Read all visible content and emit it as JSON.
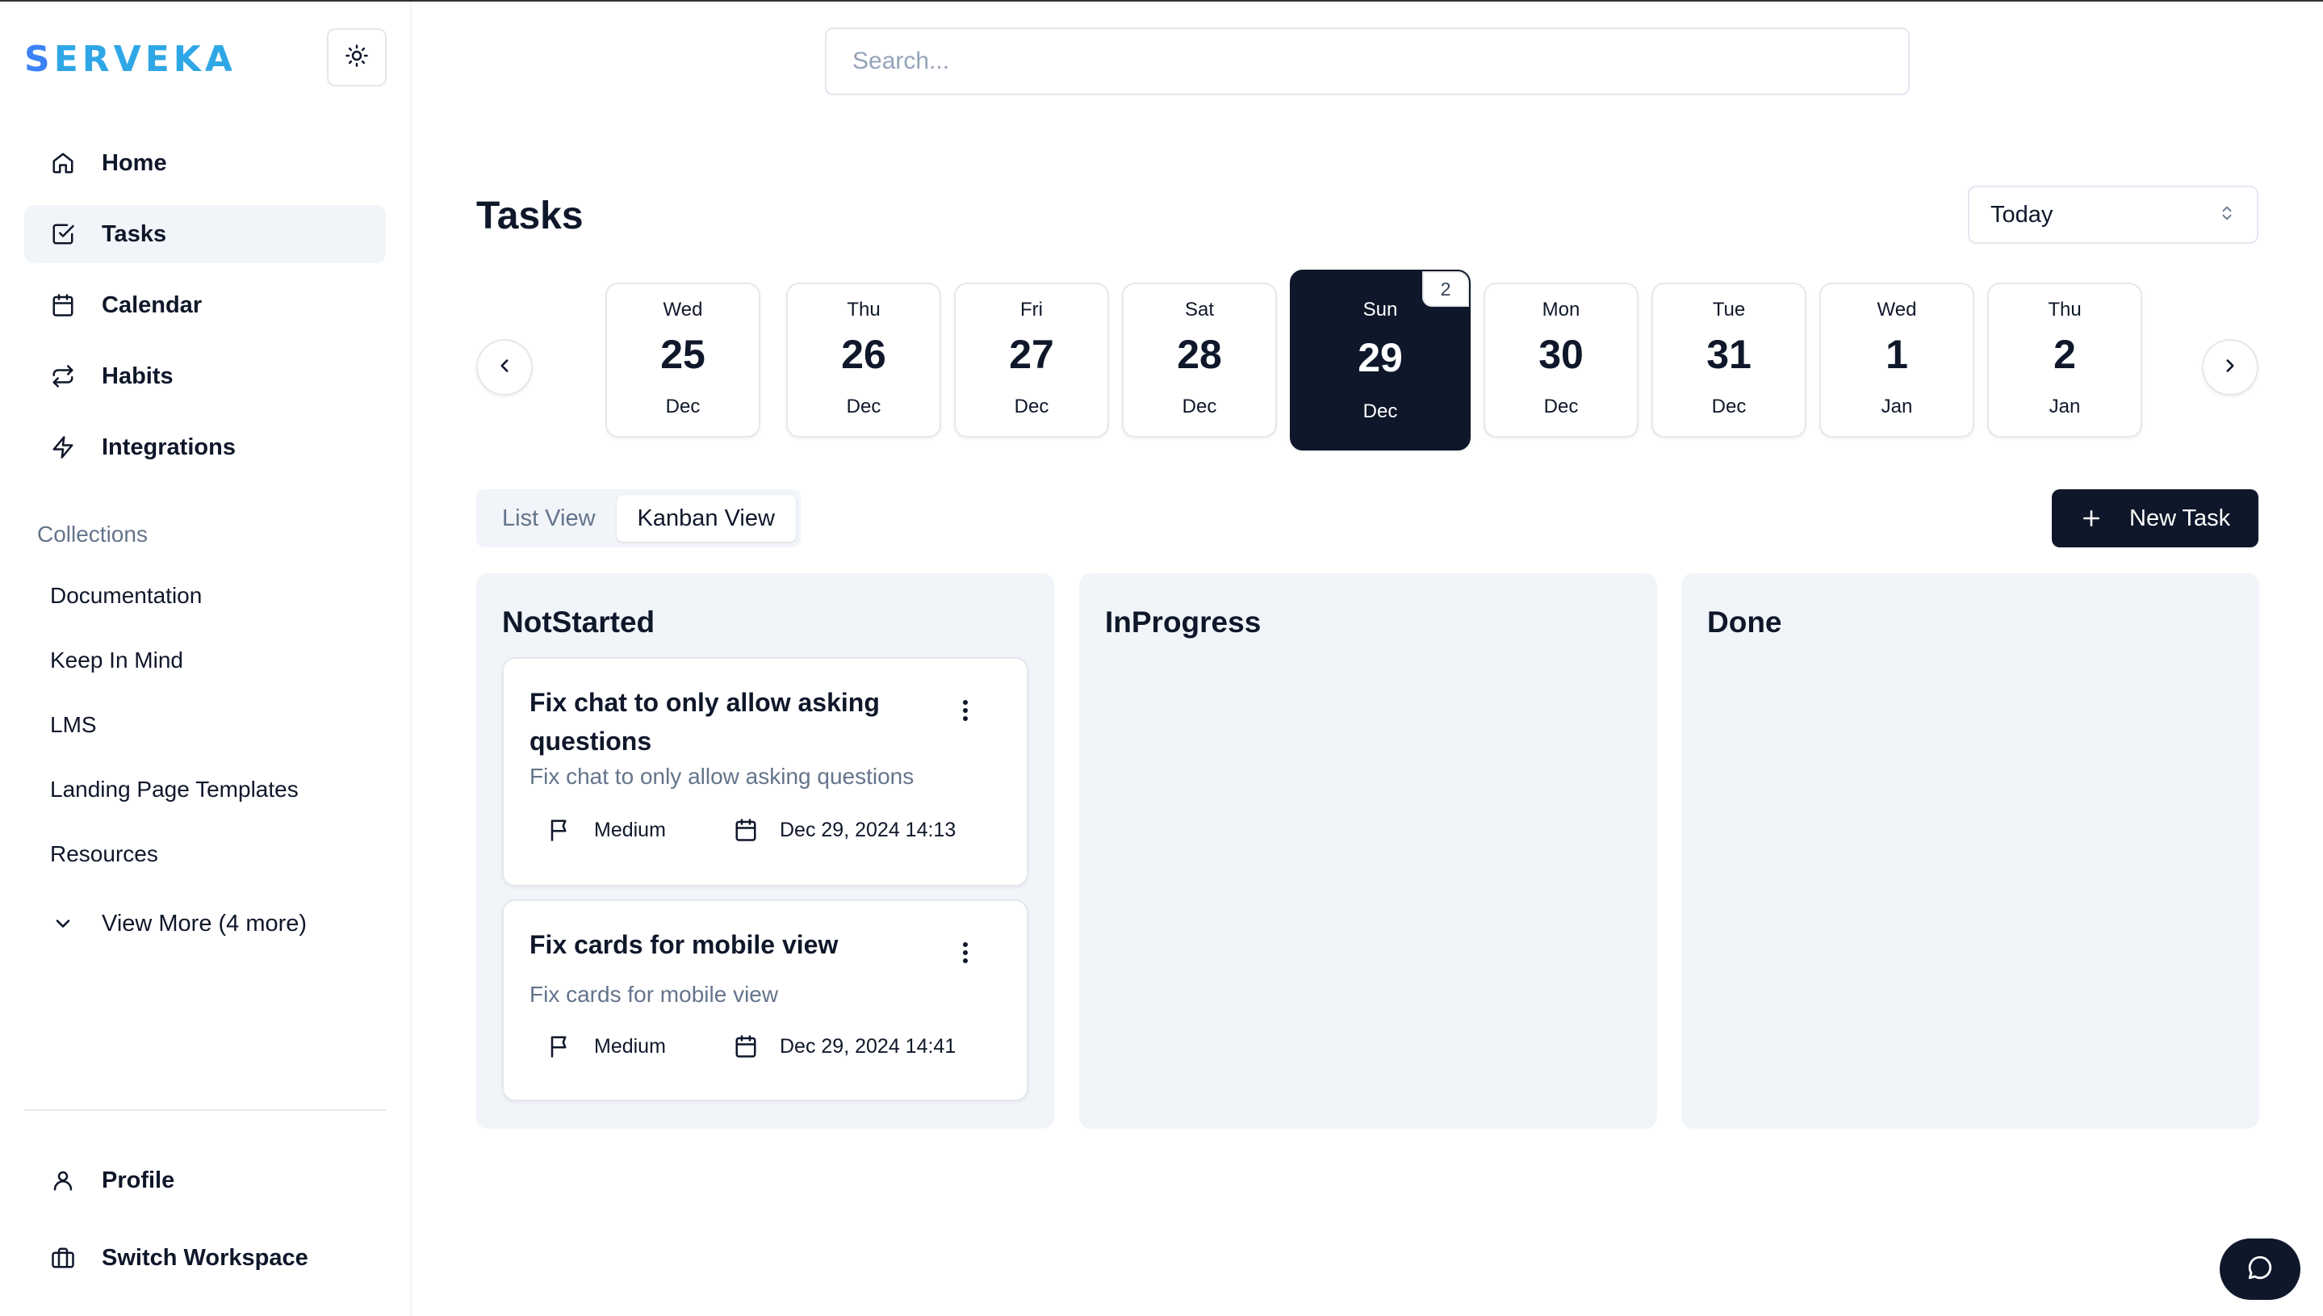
{
  "brand": {
    "logo_first": "S",
    "logo_rest": "ERVEKA"
  },
  "sidebar": {
    "nav": [
      {
        "label": "Home",
        "icon": "home-icon"
      },
      {
        "label": "Tasks",
        "icon": "checkbox-icon",
        "active": true
      },
      {
        "label": "Calendar",
        "icon": "calendar-icon"
      },
      {
        "label": "Habits",
        "icon": "repeat-icon"
      },
      {
        "label": "Integrations",
        "icon": "lightning-icon"
      }
    ],
    "collections_title": "Collections",
    "collections": [
      "Documentation",
      "Keep In Mind",
      "LMS",
      "Landing Page Templates",
      "Resources"
    ],
    "view_more": "View More (4 more)",
    "bottom": [
      {
        "label": "Profile",
        "icon": "user-icon"
      },
      {
        "label": "Switch Workspace",
        "icon": "briefcase-icon"
      }
    ]
  },
  "search": {
    "placeholder": "Search..."
  },
  "page": {
    "title": "Tasks",
    "range_value": "Today"
  },
  "dates": [
    {
      "dow": "Wed",
      "day": "25",
      "month": "Dec"
    },
    {
      "dow": "Thu",
      "day": "26",
      "month": "Dec"
    },
    {
      "dow": "Fri",
      "day": "27",
      "month": "Dec"
    },
    {
      "dow": "Sat",
      "day": "28",
      "month": "Dec"
    },
    {
      "dow": "Sun",
      "day": "29",
      "month": "Dec",
      "selected": true,
      "count": "2"
    },
    {
      "dow": "Mon",
      "day": "30",
      "month": "Dec"
    },
    {
      "dow": "Tue",
      "day": "31",
      "month": "Dec"
    },
    {
      "dow": "Wed",
      "day": "1",
      "month": "Jan"
    },
    {
      "dow": "Thu",
      "day": "2",
      "month": "Jan"
    }
  ],
  "views": {
    "list": "List View",
    "kanban": "Kanban View",
    "active": "kanban"
  },
  "new_task_label": "New Task",
  "columns": [
    {
      "title": "NotStarted",
      "tasks": [
        {
          "title": "Fix chat to only allow asking questions",
          "description": "Fix chat to only allow asking questions",
          "priority": "Medium",
          "due": "Dec 29, 2024 14:13"
        },
        {
          "title": "Fix cards for mobile view",
          "description": "Fix cards for mobile view",
          "priority": "Medium",
          "due": "Dec 29, 2024 14:41"
        }
      ]
    },
    {
      "title": "InProgress",
      "tasks": []
    },
    {
      "title": "Done",
      "tasks": []
    }
  ],
  "colors": {
    "primary": "#0f172a",
    "muted": "#64748b",
    "surface": "#f1f5f9",
    "border": "#e5e7eb",
    "logo": "#2fa7e6"
  }
}
